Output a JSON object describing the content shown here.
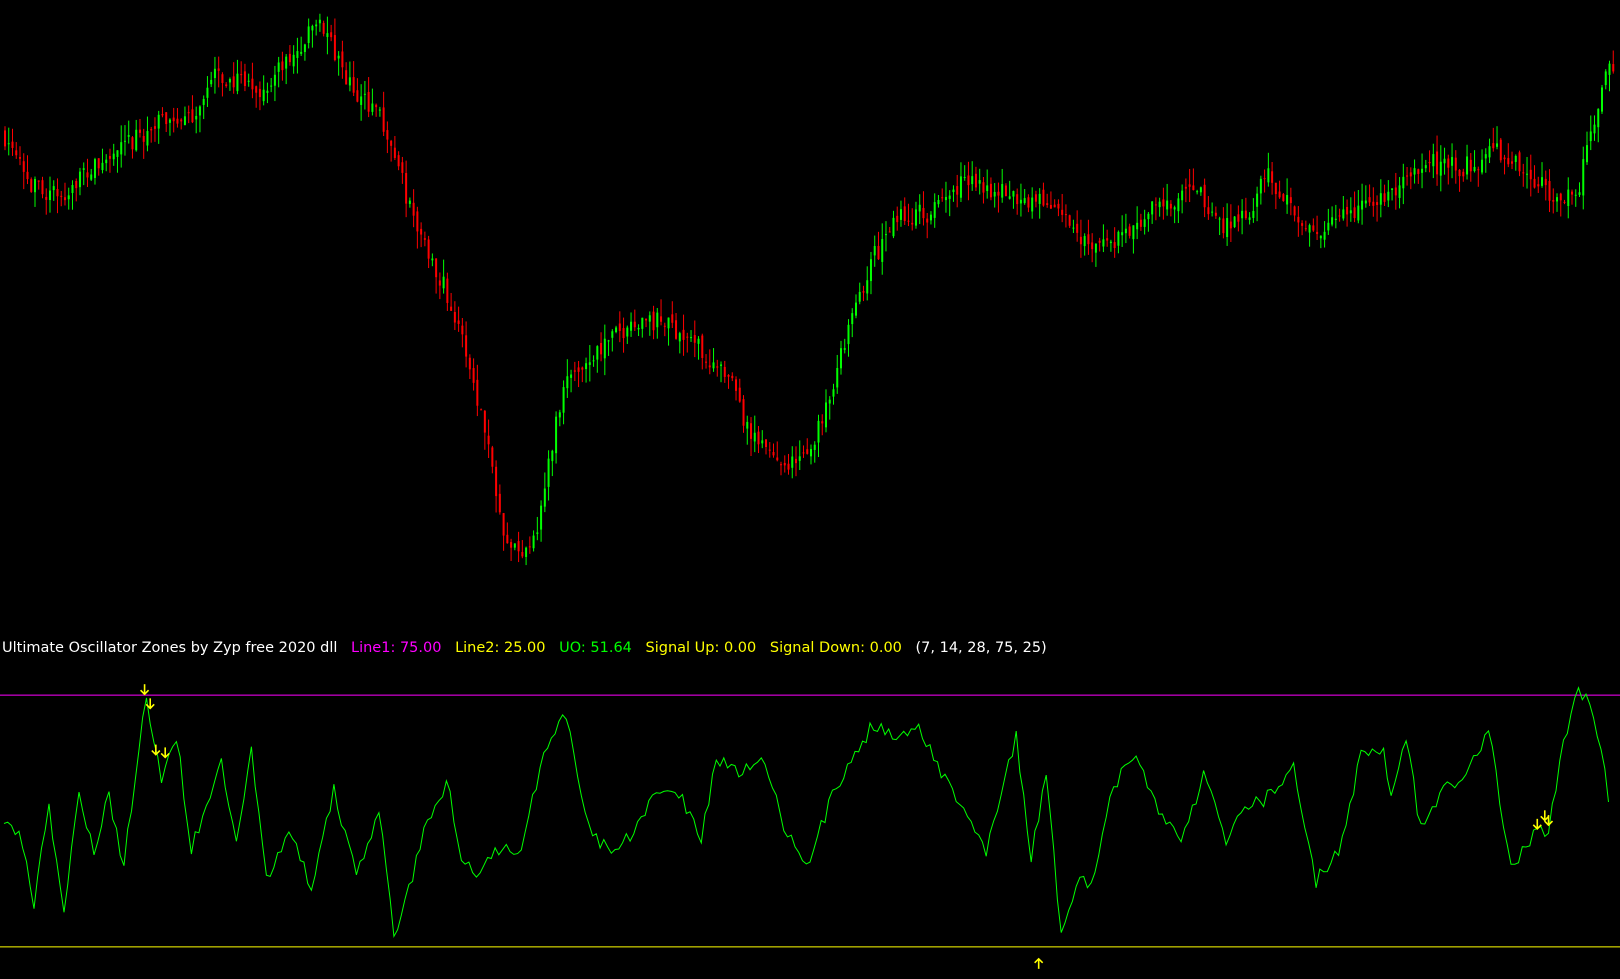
{
  "colors": {
    "background": "#000000",
    "bull_candle": "#00ff00",
    "bear_candle": "#ff0000",
    "title_text": "#ffffff",
    "line1": "#ff00ff",
    "line2": "#ffff00",
    "uo_line": "#00ff00",
    "signal_arrow": "#ffff00"
  },
  "indicator": {
    "name": "Ultimate Oscillator Zones by Zyp free 2020 dll",
    "line1_label": "Line1: 75.00",
    "line2_label": "Line2: 25.00",
    "uo_label": "UO: 51.64",
    "signal_up_label": "Signal Up: 0.00",
    "signal_down_label": "Signal Down: 0.00",
    "params_label": "(7, 14, 28, 75, 25)"
  },
  "chart_data": [
    {
      "type": "candlestick",
      "title": "",
      "grid": false,
      "bullish_color": "#00ff00",
      "bearish_color": "#ff0000",
      "ylim": [
        0,
        100
      ],
      "close_path": [
        [
          0,
          80
        ],
        [
          4,
          78
        ],
        [
          8,
          71
        ],
        [
          12,
          70
        ],
        [
          16,
          69
        ],
        [
          20,
          72
        ],
        [
          25,
          74
        ],
        [
          32,
          77
        ],
        [
          38,
          80
        ],
        [
          45,
          83
        ],
        [
          50,
          82
        ],
        [
          57,
          90
        ],
        [
          62,
          89
        ],
        [
          70,
          87
        ],
        [
          74,
          91
        ],
        [
          78,
          93
        ],
        [
          85,
          100
        ],
        [
          90,
          92
        ],
        [
          95,
          86
        ],
        [
          100,
          85
        ],
        [
          105,
          76
        ],
        [
          110,
          65
        ],
        [
          118,
          54
        ],
        [
          125,
          40
        ],
        [
          130,
          26
        ],
        [
          134,
          12
        ],
        [
          138,
          7
        ],
        [
          143,
          12
        ],
        [
          150,
          37
        ],
        [
          160,
          43
        ],
        [
          170,
          48
        ],
        [
          178,
          47
        ],
        [
          185,
          44
        ],
        [
          195,
          36
        ],
        [
          200,
          27
        ],
        [
          205,
          25
        ],
        [
          210,
          23
        ],
        [
          215,
          24
        ],
        [
          220,
          33
        ],
        [
          226,
          46
        ],
        [
          232,
          58
        ],
        [
          240,
          66
        ],
        [
          248,
          66
        ],
        [
          255,
          71
        ],
        [
          260,
          72
        ],
        [
          266,
          70
        ],
        [
          271,
          69
        ],
        [
          280,
          68
        ],
        [
          288,
          62
        ],
        [
          296,
          61
        ],
        [
          304,
          64
        ],
        [
          308,
          68
        ],
        [
          313,
          67
        ],
        [
          318,
          71
        ],
        [
          325,
          64
        ],
        [
          333,
          67
        ],
        [
          338,
          73
        ],
        [
          345,
          67
        ],
        [
          350,
          62
        ],
        [
          362,
          67
        ],
        [
          372,
          70
        ],
        [
          380,
          75
        ],
        [
          390,
          74
        ],
        [
          396,
          76
        ],
        [
          400,
          77
        ],
        [
          408,
          72
        ],
        [
          416,
          69
        ],
        [
          421,
          71
        ],
        [
          428,
          91
        ]
      ]
    },
    {
      "type": "line",
      "title": "Ultimate Oscillator Zones by Zyp free 2020 dll",
      "series_name": "UO",
      "ylim": [
        0,
        100
      ],
      "grid": false,
      "levels": [
        {
          "name": "Line1",
          "value": 75.0,
          "color": "#ff00ff"
        },
        {
          "name": "Line2",
          "value": 25.0,
          "color": "#ffff00"
        }
      ],
      "last_value": 51.64,
      "x": [
        0,
        4,
        8,
        12,
        16,
        20,
        24,
        28,
        32,
        36,
        38,
        42,
        46,
        50,
        54,
        58,
        62,
        66,
        70,
        76,
        82,
        88,
        94,
        100,
        104,
        108,
        112,
        116,
        118,
        122,
        126,
        130,
        138,
        144,
        150,
        156,
        162,
        168,
        174,
        180,
        186,
        190,
        196,
        202,
        208,
        214,
        220,
        226,
        232,
        238,
        244,
        250,
        256,
        262,
        266,
        270,
        274,
        278,
        282,
        286,
        290,
        296,
        302,
        308,
        314,
        320,
        326,
        332,
        338,
        344,
        350,
        356,
        362,
        368,
        370,
        374,
        378,
        384,
        390,
        396,
        402,
        408,
        412,
        416,
        420,
        424,
        428
      ],
      "values": [
        51,
        47,
        34,
        53,
        31,
        56,
        44,
        55,
        41,
        65,
        74,
        58,
        67,
        44,
        54,
        61,
        47,
        64,
        38,
        48,
        37,
        56,
        39,
        52,
        27,
        36,
        49,
        53,
        59,
        43,
        38,
        44,
        44,
        64,
        71,
        48,
        44,
        48,
        55,
        56,
        46,
        63,
        59,
        63,
        49,
        41,
        53,
        63,
        69,
        66,
        69,
        59,
        52,
        44,
        56,
        67,
        43,
        59,
        28,
        38,
        38,
        57,
        63,
        52,
        45,
        59,
        46,
        53,
        55,
        61,
        38,
        44,
        63,
        64,
        55,
        67,
        48,
        56,
        58,
        69,
        40,
        47,
        48,
        65,
        76,
        72,
        55
      ],
      "signals": {
        "down_arrows": [
          37.5,
          39,
          40.5,
          43,
          409,
          411,
          412
        ],
        "up_arrows": [
          276
        ]
      }
    }
  ]
}
